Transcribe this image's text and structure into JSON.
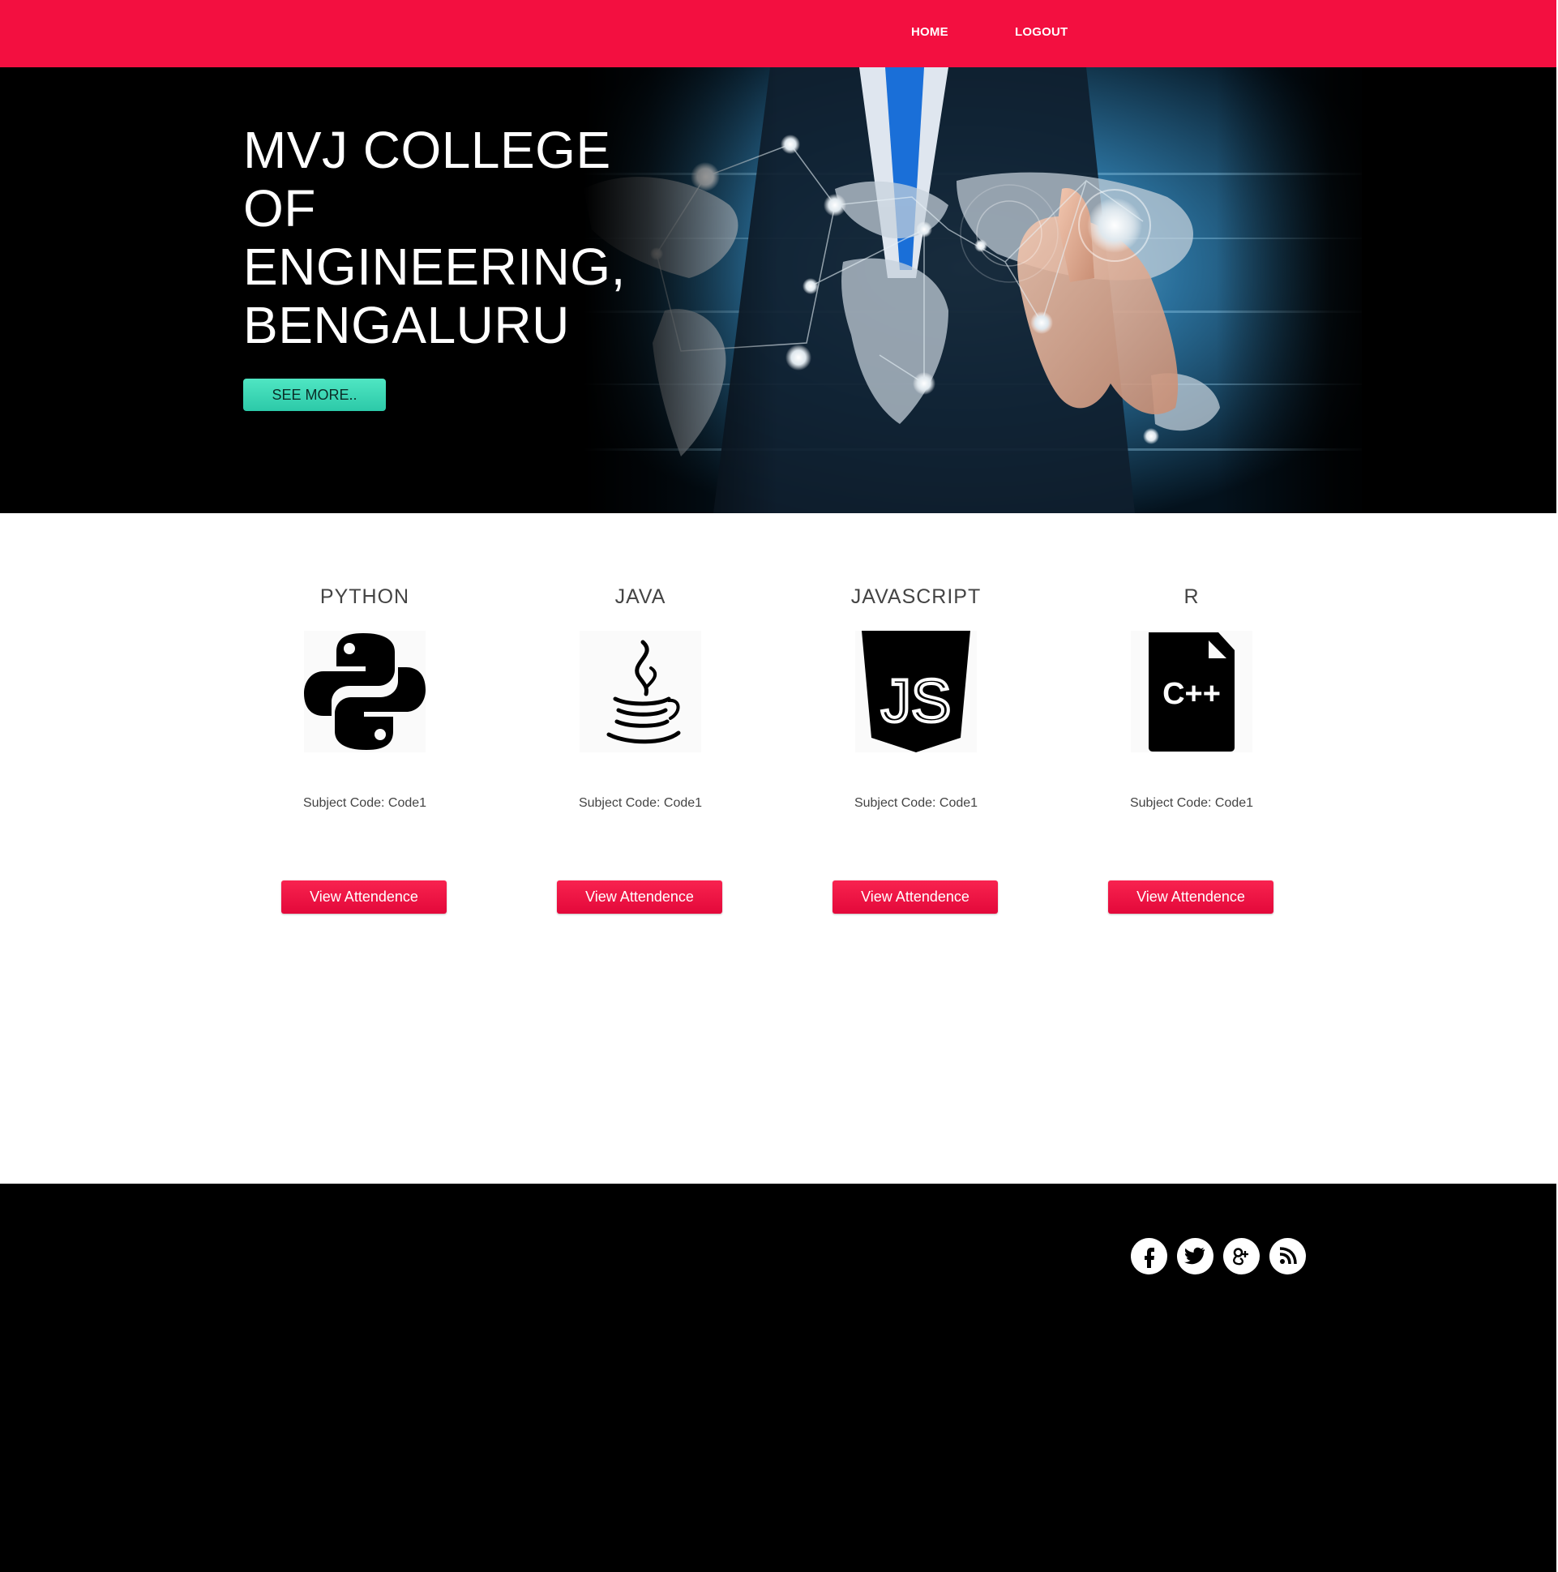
{
  "nav": {
    "home_label": "HOME",
    "logout_label": "LOGOUT",
    "background_color": "#f30f40"
  },
  "hero": {
    "title": "MVJ COLLEGE OF ENGINEERING, BENGALURU",
    "button_label": "SEE MORE..",
    "button_color": "#3ddbb8",
    "image": "businessman-touching-world-map-network"
  },
  "subjects": [
    {
      "name": "PYTHON",
      "icon": "python-logo-icon",
      "code_text": "Subject Code: Code1",
      "button_label": "View Attendence"
    },
    {
      "name": "JAVA",
      "icon": "java-coffee-cup-icon",
      "code_text": "Subject Code: Code1",
      "button_label": "View Attendence"
    },
    {
      "name": "JAVASCRIPT",
      "icon": "js-shield-icon",
      "code_text": "Subject Code: Code1",
      "button_label": "View Attendence"
    },
    {
      "name": "R",
      "icon": "cpp-file-icon",
      "code_text": "Subject Code: Code1",
      "button_label": "View Attendence"
    }
  ],
  "icon_text": {
    "js": "JS",
    "cpp": "C++"
  },
  "accent_color": "#ed0f3f",
  "footer": {
    "background_color": "#000000",
    "social": [
      "facebook-icon",
      "twitter-icon",
      "google-plus-icon",
      "rss-icon"
    ]
  }
}
